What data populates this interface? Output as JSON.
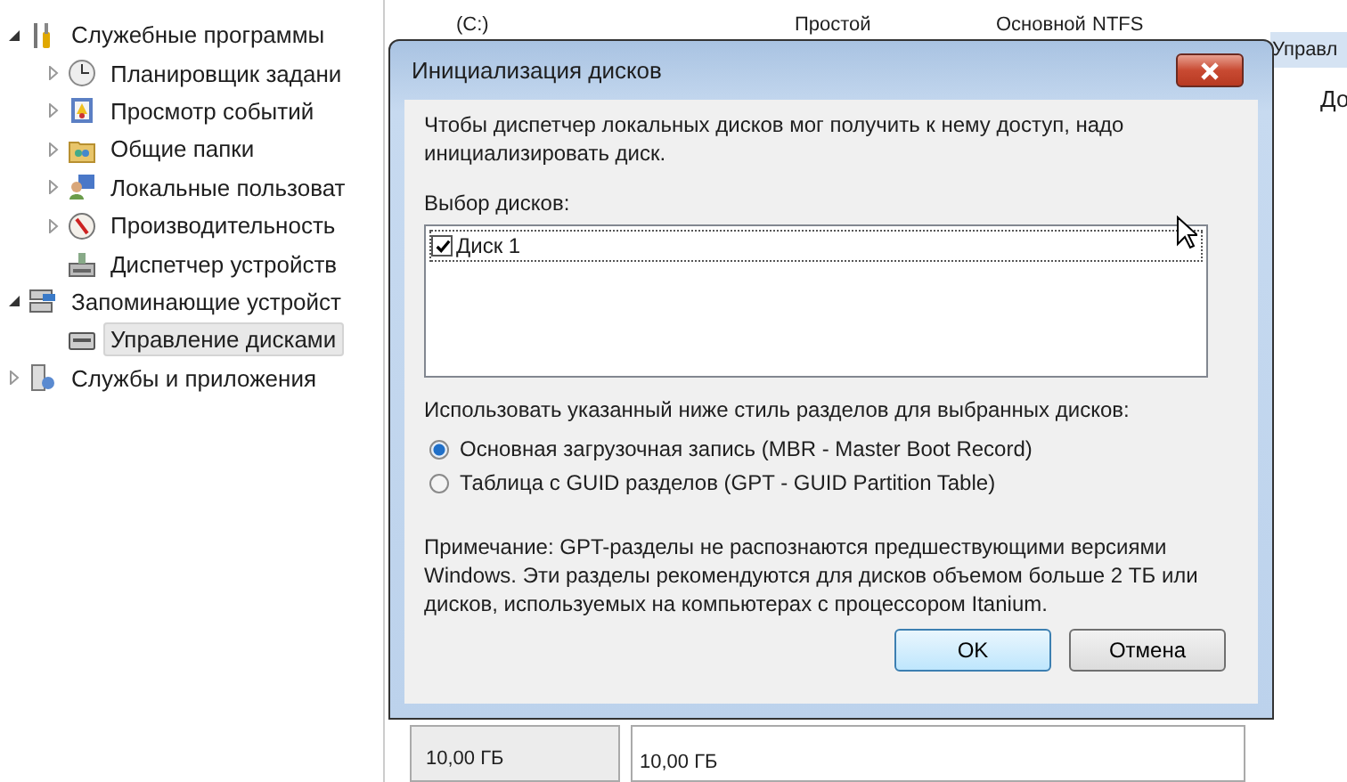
{
  "tree": [
    {
      "label": "Служебные программы",
      "kind": "tools",
      "expanded": true,
      "selected": false,
      "children": [
        {
          "label": "Планировщик задани",
          "kind": "clock",
          "expanded": false,
          "selected": false
        },
        {
          "label": "Просмотр событий",
          "kind": "log",
          "expanded": false,
          "selected": false
        },
        {
          "label": "Общие папки",
          "kind": "folder",
          "expanded": false,
          "selected": false
        },
        {
          "label": "Локальные пользоват",
          "kind": "users",
          "expanded": false,
          "selected": false
        },
        {
          "label": "Производительность",
          "kind": "gauge",
          "expanded": false,
          "selected": false
        },
        {
          "label": "Диспетчер устройств",
          "kind": "device",
          "selected": false
        }
      ]
    },
    {
      "label": "Запоминающие устройст",
      "kind": "storage",
      "expanded": true,
      "selected": false,
      "children": [
        {
          "label": "Управление дисками",
          "kind": "disk",
          "selected": true
        }
      ]
    },
    {
      "label": "Службы и приложения",
      "kind": "services",
      "expanded": false,
      "selected": false
    }
  ],
  "volume_row": {
    "name": "(C:)",
    "layout": "Простой",
    "type": "Основной",
    "fs": "NTFS"
  },
  "disk_panel": {
    "size": "10,00 ГБ",
    "partition_size": "10,00 ГБ"
  },
  "actions_pane": {
    "header": "Управл",
    "item": "До"
  },
  "dialog": {
    "title": "Инициализация дисков",
    "intro": "Чтобы диспетчер локальных дисков мог получить к нему доступ, надо инициализировать диск.",
    "disks_label": "Выбор дисков:",
    "disks": [
      {
        "label": "Диск 1",
        "checked": true
      }
    ],
    "style_label": "Использовать указанный ниже стиль разделов для выбранных дисков:",
    "styles": [
      {
        "label": "Основная загрузочная запись (MBR - Master Boot Record)",
        "selected": true
      },
      {
        "label": "Таблица с GUID разделов (GPT - GUID Partition Table)",
        "selected": false
      }
    ],
    "note": "Примечание: GPT-разделы не распознаются предшествующими версиями Windows. Эти разделы рекомендуются для дисков объемом больше 2 ТБ или дисков, используемых на компьютерах с процессором Itanium.",
    "buttons": [
      {
        "label": "OK",
        "default": true
      },
      {
        "label": "Отмена",
        "default": false
      }
    ]
  }
}
